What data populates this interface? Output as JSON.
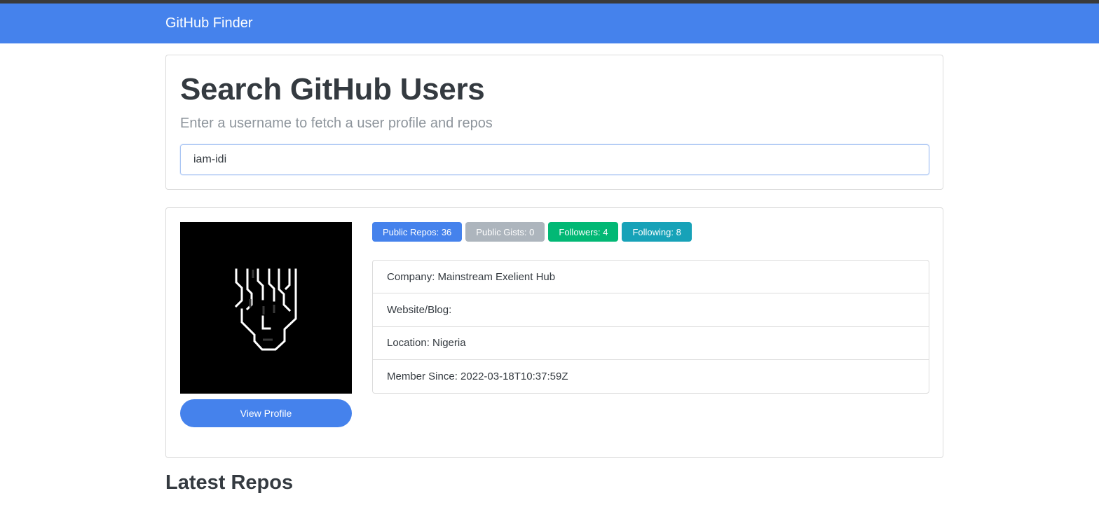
{
  "navbar": {
    "brand": "GitHub Finder"
  },
  "search": {
    "title": "Search GitHub Users",
    "subtitle": "Enter a username to fetch a user profile and repos",
    "input_value": "iam-idi"
  },
  "profile": {
    "view_profile_label": "View Profile",
    "badges": [
      {
        "label": "Public Repos: 36",
        "color": "#4582ec"
      },
      {
        "label": "Public Gists: 0",
        "color": "#adb5bd"
      },
      {
        "label": "Followers: 4",
        "color": "#02b875"
      },
      {
        "label": "Following: 8",
        "color": "#17a2b8"
      }
    ],
    "details": [
      "Company: Mainstream Exelient Hub",
      "Website/Blog:",
      "Location: Nigeria",
      "Member Since: 2022-03-18T10:37:59Z"
    ]
  },
  "repos": {
    "title": "Latest Repos"
  }
}
